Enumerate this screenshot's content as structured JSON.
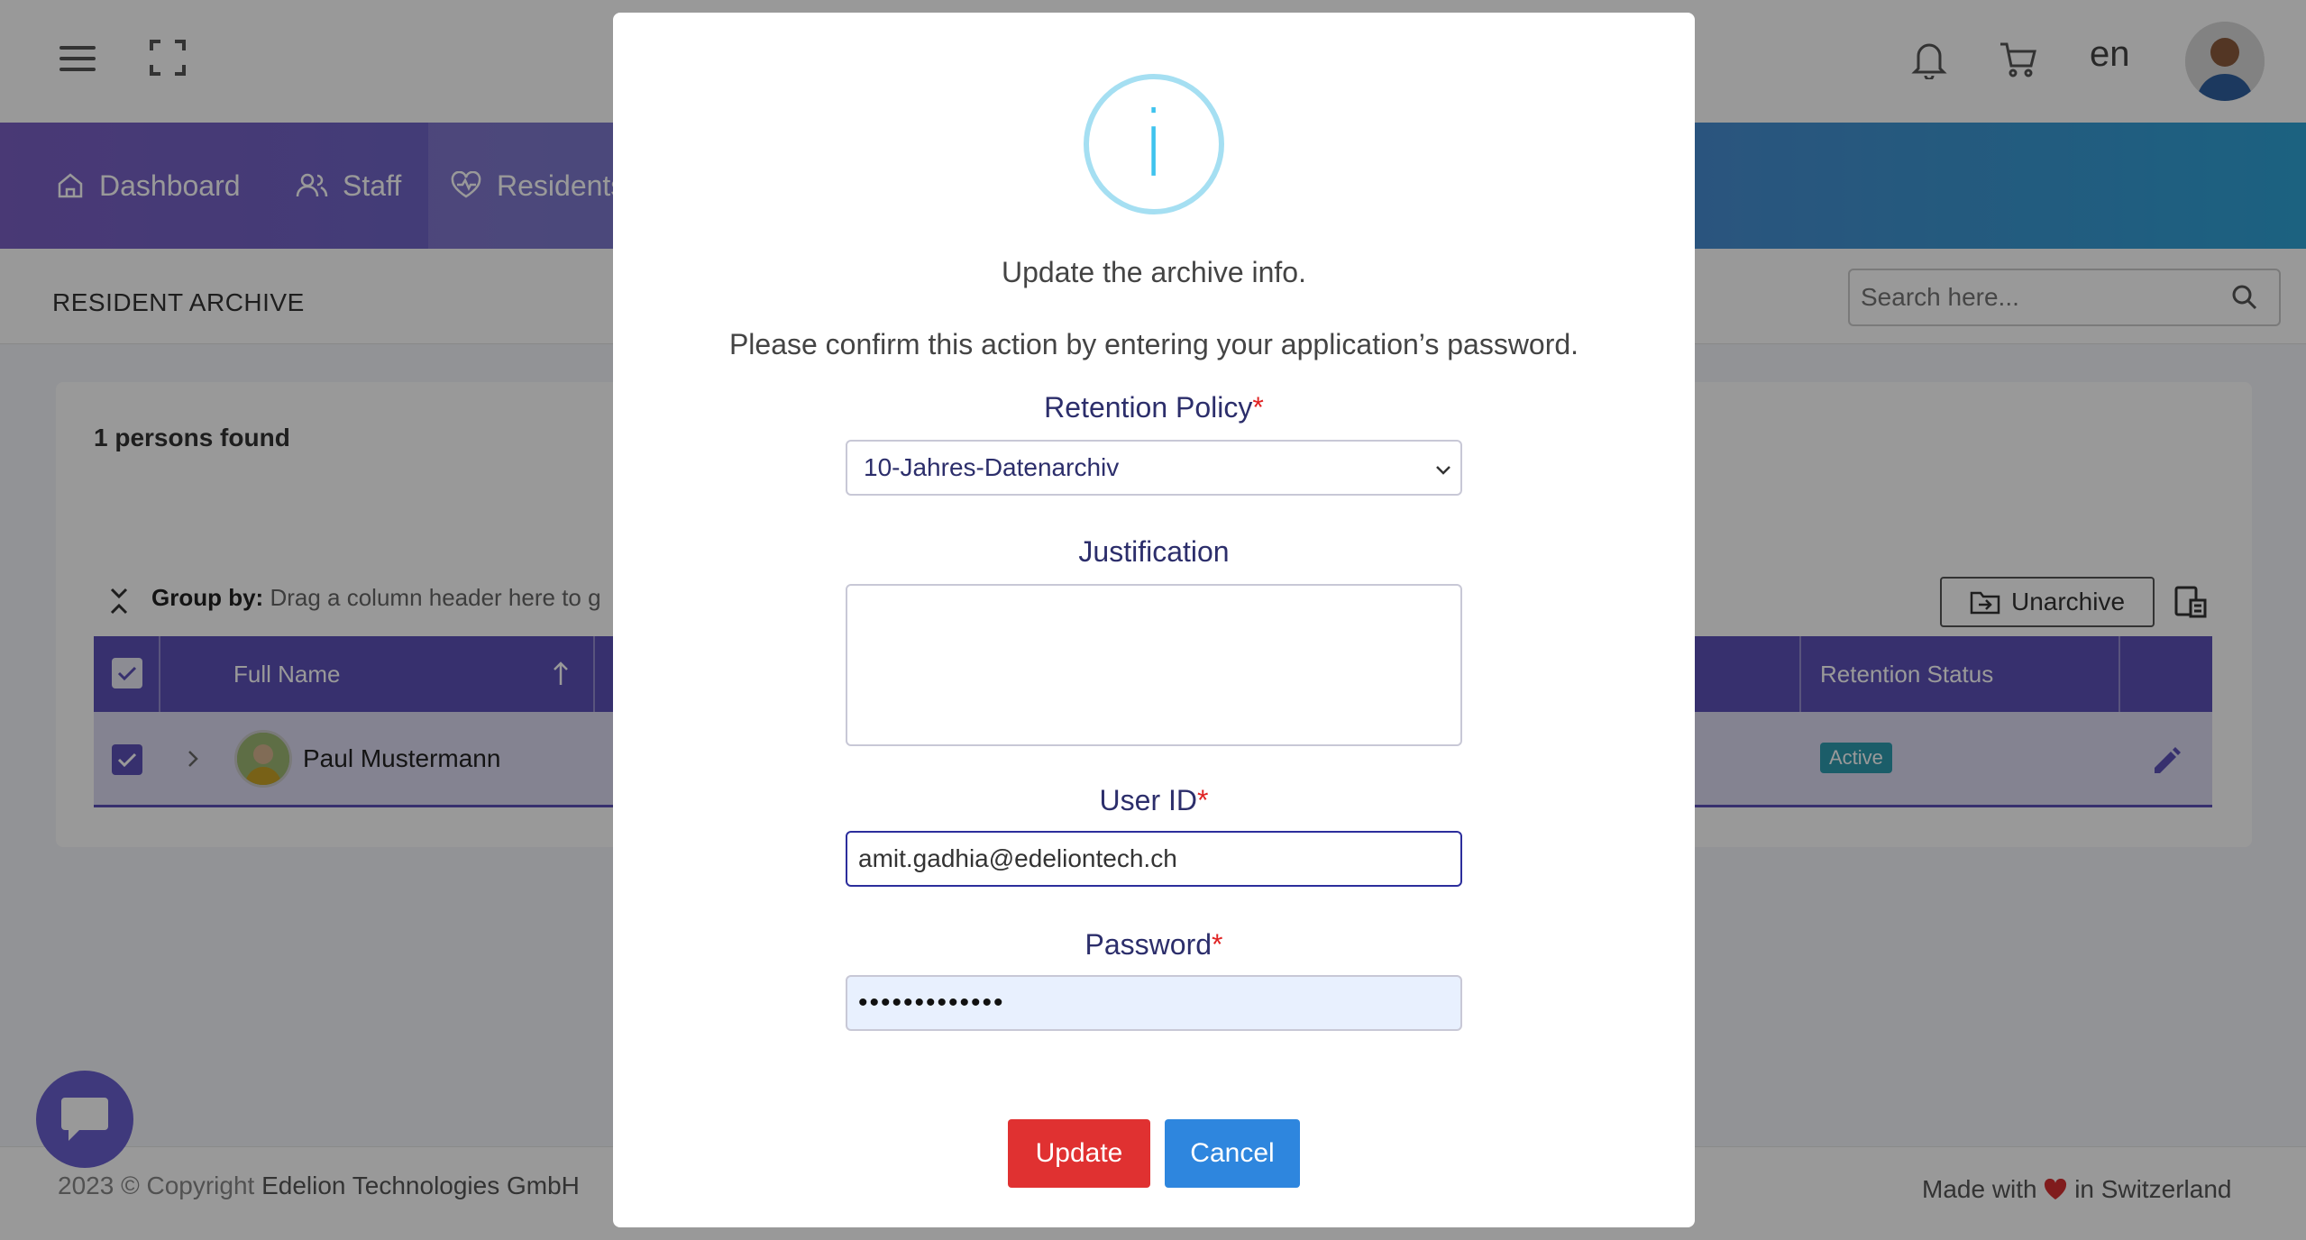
{
  "header": {
    "language": "en"
  },
  "nav": {
    "items": [
      {
        "label": "Dashboard",
        "icon": "home-icon"
      },
      {
        "label": "Staff",
        "icon": "users-icon"
      },
      {
        "label": "Residents",
        "icon": "heart-pulse-icon"
      }
    ]
  },
  "page": {
    "title": "RESIDENT ARCHIVE",
    "search_placeholder": "Search here..."
  },
  "grid": {
    "found_text": "1 persons found",
    "group_by_label": "Group by:",
    "group_by_hint": "Drag a column header here to g",
    "unarchive_label": "Unarchive",
    "columns": [
      "Full Name",
      "Retention Status"
    ],
    "rows": [
      {
        "full_name": "Paul Mustermann",
        "retention_status": "Active"
      }
    ]
  },
  "footer": {
    "copyright_prefix": "2023 © Copyright",
    "company": "Edelion Technologies GmbH",
    "made_with": "Made with",
    "made_in": "in Switzerland"
  },
  "modal": {
    "icon": "info-icon",
    "icon_glyph": "i",
    "title": "Update the archive info.",
    "subtitle": "Please confirm this action by entering your application’s password.",
    "retention_label": "Retention Policy",
    "retention_value": "10-Jahres-Datenarchiv",
    "justification_label": "Justification",
    "justification_value": "",
    "user_id_label": "User ID",
    "user_id_value": "amit.gadhia@edeliontech.ch",
    "password_label": "Password",
    "password_value": "•••••••••••••",
    "required_mark": "*",
    "update_label": "Update",
    "cancel_label": "Cancel"
  },
  "colors": {
    "nav_gradient_start": "#7a5fc4",
    "nav_gradient_end": "#2fa3d6",
    "grid_header": "#5c51b8",
    "update_button": "#e03131",
    "cancel_button": "#2e86de",
    "info_icon": "#3fc3ee",
    "status_badge": "#2d9bb0"
  }
}
